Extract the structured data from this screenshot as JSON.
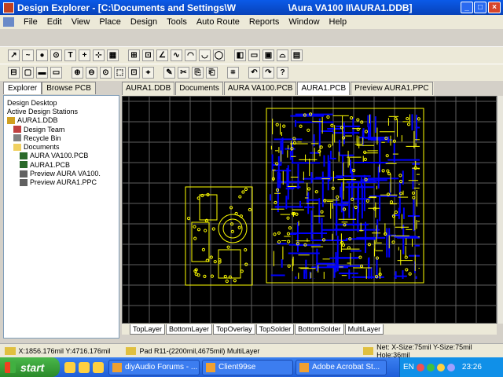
{
  "window": {
    "title": "Design Explorer - [C:\\Documents and Settings\\W                    \\Aura VA100 II\\AURA1.DDB]",
    "min_label": "_",
    "max_label": "□",
    "close_label": "×"
  },
  "menu": [
    "File",
    "Edit",
    "View",
    "Place",
    "Design",
    "Tools",
    "Auto Route",
    "Reports",
    "Window",
    "Help"
  ],
  "toolbars": {
    "row1": [
      "↗",
      "~",
      "●",
      "⊙",
      "T",
      "+",
      "⊹",
      "▦",
      "",
      "⊞",
      "⊡",
      "∠",
      "∿",
      "◠",
      "◡",
      "◯",
      "",
      "◧",
      "▭",
      "▣",
      "⌓",
      "▤"
    ],
    "row2": [
      "⊟",
      "▢",
      "▬",
      "▭",
      "",
      "⊕",
      "⊖",
      "⊙",
      "⬚",
      "⊡",
      "⌖",
      "",
      "✎",
      "✂",
      "⎘",
      "⎗",
      "",
      "⌗",
      "",
      "↶",
      "↷",
      "?"
    ]
  },
  "left_tabs": [
    "Explorer",
    "Browse PCB"
  ],
  "tree": [
    {
      "label": "Design Desktop",
      "indent": 0,
      "icon": "desktop-icon"
    },
    {
      "label": "Active Design Stations",
      "indent": 0,
      "icon": "station-icon"
    },
    {
      "label": "AURA1.DDB",
      "indent": 0,
      "icon": "database-icon"
    },
    {
      "label": "Design Team",
      "indent": 1,
      "icon": "team-icon"
    },
    {
      "label": "Recycle Bin",
      "indent": 1,
      "icon": "recycle-icon"
    },
    {
      "label": "Documents",
      "indent": 1,
      "icon": "folder-icon"
    },
    {
      "label": "AURA VA100.PCB",
      "indent": 2,
      "icon": "pcb-icon"
    },
    {
      "label": "AURA1.PCB",
      "indent": 2,
      "icon": "pcb-icon"
    },
    {
      "label": "Preview AURA VA100.",
      "indent": 2,
      "icon": "preview-icon"
    },
    {
      "label": "Preview AURA1.PPC",
      "indent": 2,
      "icon": "preview-icon"
    }
  ],
  "doc_tabs": [
    "AURA1.DDB",
    "Documents",
    "AURA VA100.PCB",
    "AURA1.PCB",
    "Preview AURA1.PPC"
  ],
  "active_doc_tab": 3,
  "layer_tabs": [
    "TopLayer",
    "BottomLayer",
    "TopOverlay",
    "TopSolder",
    "BottomSolder",
    "MultiLayer"
  ],
  "status": {
    "coords": "X:1856.176mil Y:4716.176mil",
    "pad": "Pad R11-(2200mil,4675mil)  MultiLayer",
    "net": "Net:  X-Size:75mil Y-Size:75mil Hole:36mil"
  },
  "taskbar": {
    "start_label": "start",
    "tasks": [
      "diyAudio Forums - ...",
      "Client99se",
      "Adobe Acrobat St..."
    ],
    "lang": "EN",
    "clock": "23:26"
  },
  "colors": {
    "pcb_bg": "#000000",
    "grid": "#606060",
    "overlay": "#ffff00",
    "bottom_layer": "#0000ff"
  }
}
